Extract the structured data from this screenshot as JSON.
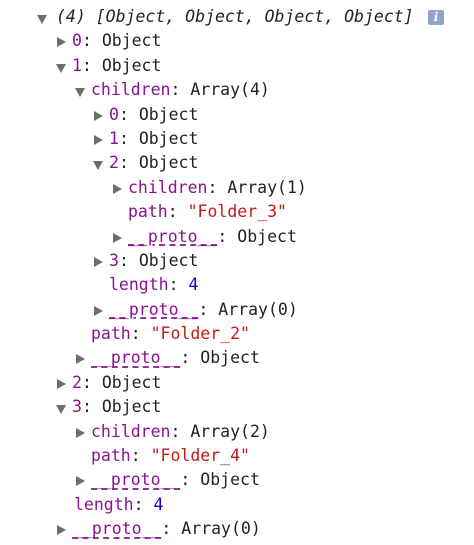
{
  "root": {
    "summary": "(4) [Object, Object, Object, Object]",
    "info_icon": "i"
  },
  "rows": [
    {
      "key": "0",
      "sep": ": ",
      "value": "Object"
    },
    {
      "key": "1",
      "sep": ": ",
      "value": "Object"
    },
    {
      "key": "children",
      "sep": ": ",
      "value": "Array(4)"
    },
    {
      "key": "0",
      "sep": ": ",
      "value": "Object"
    },
    {
      "key": "1",
      "sep": ": ",
      "value": "Object"
    },
    {
      "key": "2",
      "sep": ": ",
      "value": "Object"
    },
    {
      "key": "children",
      "sep": ": ",
      "value": "Array(1)"
    },
    {
      "key": "path",
      "sep": ": ",
      "value": "\"Folder_3\""
    },
    {
      "key": "__proto__",
      "sep": ": ",
      "value": "Object"
    },
    {
      "key": "3",
      "sep": ": ",
      "value": "Object"
    },
    {
      "key": "length",
      "sep": ": ",
      "value": "4"
    },
    {
      "key": "__proto__",
      "sep": ": ",
      "value": "Array(0)"
    },
    {
      "key": "path",
      "sep": ": ",
      "value": "\"Folder_2\""
    },
    {
      "key": "__proto__",
      "sep": ": ",
      "value": "Object"
    },
    {
      "key": "2",
      "sep": ": ",
      "value": "Object"
    },
    {
      "key": "3",
      "sep": ": ",
      "value": "Object"
    },
    {
      "key": "children",
      "sep": ": ",
      "value": "Array(2)"
    },
    {
      "key": "path",
      "sep": ": ",
      "value": "\"Folder_4\""
    },
    {
      "key": "__proto__",
      "sep": ": ",
      "value": "Object"
    },
    {
      "key": "length",
      "sep": ": ",
      "value": "4"
    },
    {
      "key": "__proto__",
      "sep": ": ",
      "value": "Array(0)"
    }
  ]
}
